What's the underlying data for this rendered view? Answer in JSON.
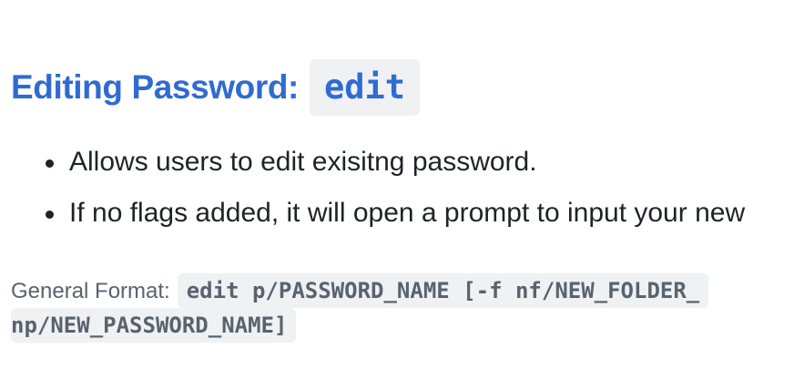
{
  "section": {
    "heading_text": "Editing Password:",
    "heading_code": "edit"
  },
  "bullets": [
    "Allows users to edit exisitng password.",
    "If no flags added, it will open a prompt to input your new"
  ],
  "general_format": {
    "label": "General Format:",
    "code_line_1": "edit p/PASSWORD_NAME [-f nf/NEW_FOLDER_",
    "code_line_2": "np/NEW_PASSWORD_NAME]"
  },
  "colors": {
    "heading": "#2f6bd1",
    "code_background": "#eff1f3",
    "muted_text": "#59636e"
  }
}
